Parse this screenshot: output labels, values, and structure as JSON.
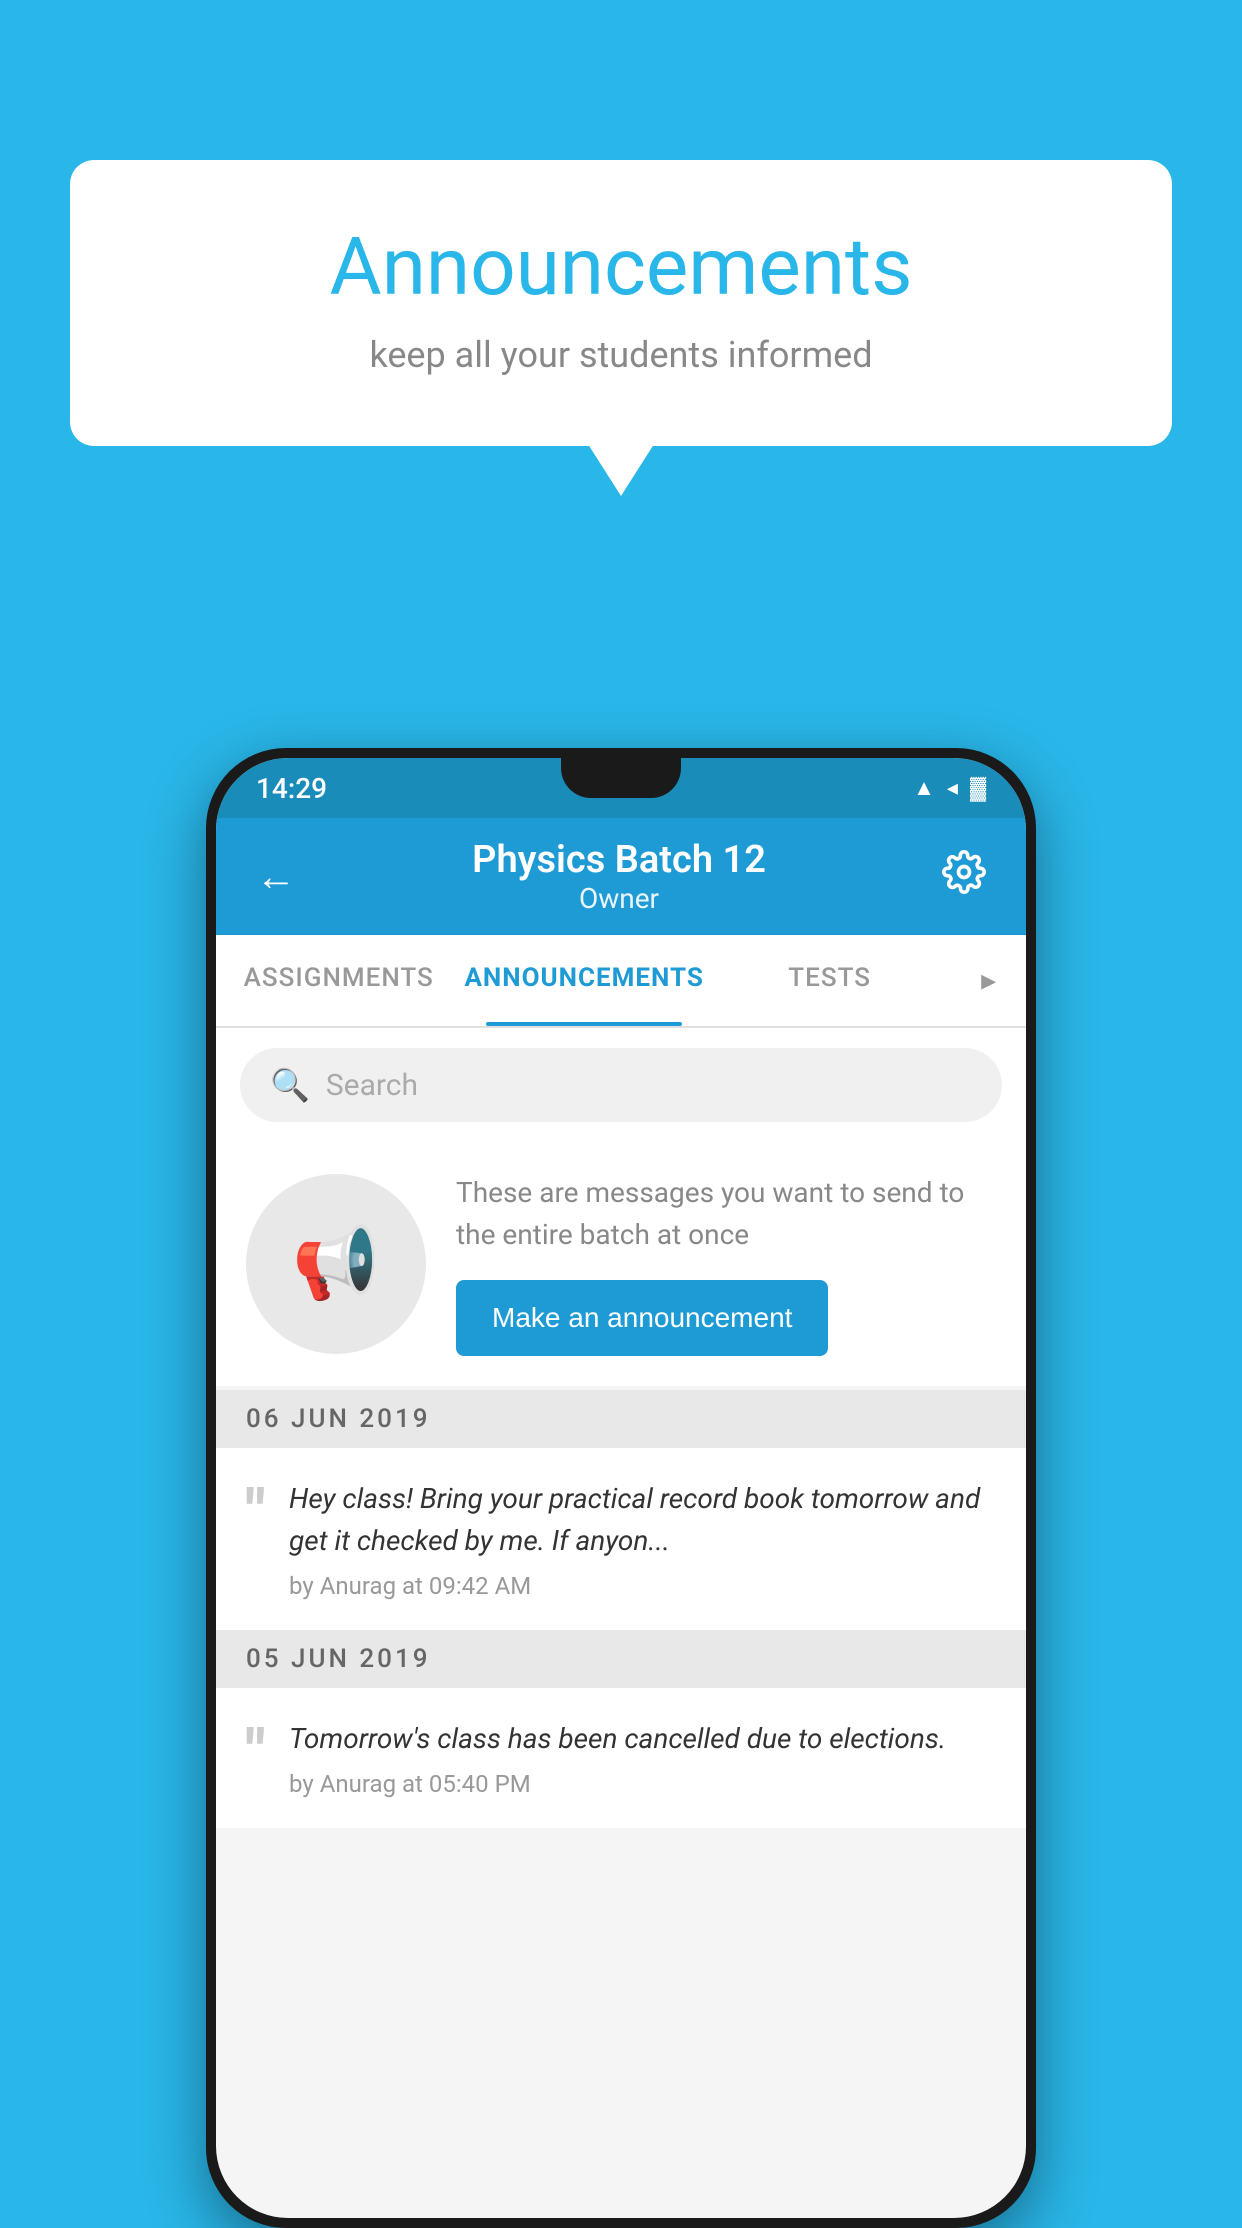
{
  "page": {
    "background_color": "#29b6e8"
  },
  "speech_bubble": {
    "title": "Announcements",
    "subtitle": "keep all your students informed"
  },
  "status_bar": {
    "time": "14:29",
    "wifi_icon": "wifi-icon",
    "signal_icon": "signal-icon",
    "battery_icon": "battery-icon"
  },
  "header": {
    "back_label": "←",
    "title": "Physics Batch 12",
    "subtitle": "Owner",
    "settings_icon": "settings-icon"
  },
  "tabs": [
    {
      "id": "assignments",
      "label": "ASSIGNMENTS",
      "active": false
    },
    {
      "id": "announcements",
      "label": "ANNOUNCEMENTS",
      "active": true
    },
    {
      "id": "tests",
      "label": "TESTS",
      "active": false
    },
    {
      "id": "more",
      "label": "▸",
      "active": false
    }
  ],
  "search": {
    "placeholder": "Search"
  },
  "promo": {
    "description": "These are messages you want to send to the entire batch at once",
    "button_label": "Make an announcement"
  },
  "announcements": [
    {
      "date": "06  JUN  2019",
      "items": [
        {
          "text": "Hey class! Bring your practical record book tomorrow and get it checked by me. If anyon...",
          "meta": "by Anurag at 09:42 AM"
        }
      ]
    },
    {
      "date": "05  JUN  2019",
      "items": [
        {
          "text": "Tomorrow's class has been cancelled due to elections.",
          "meta": "by Anurag at 05:40 PM"
        }
      ]
    }
  ]
}
